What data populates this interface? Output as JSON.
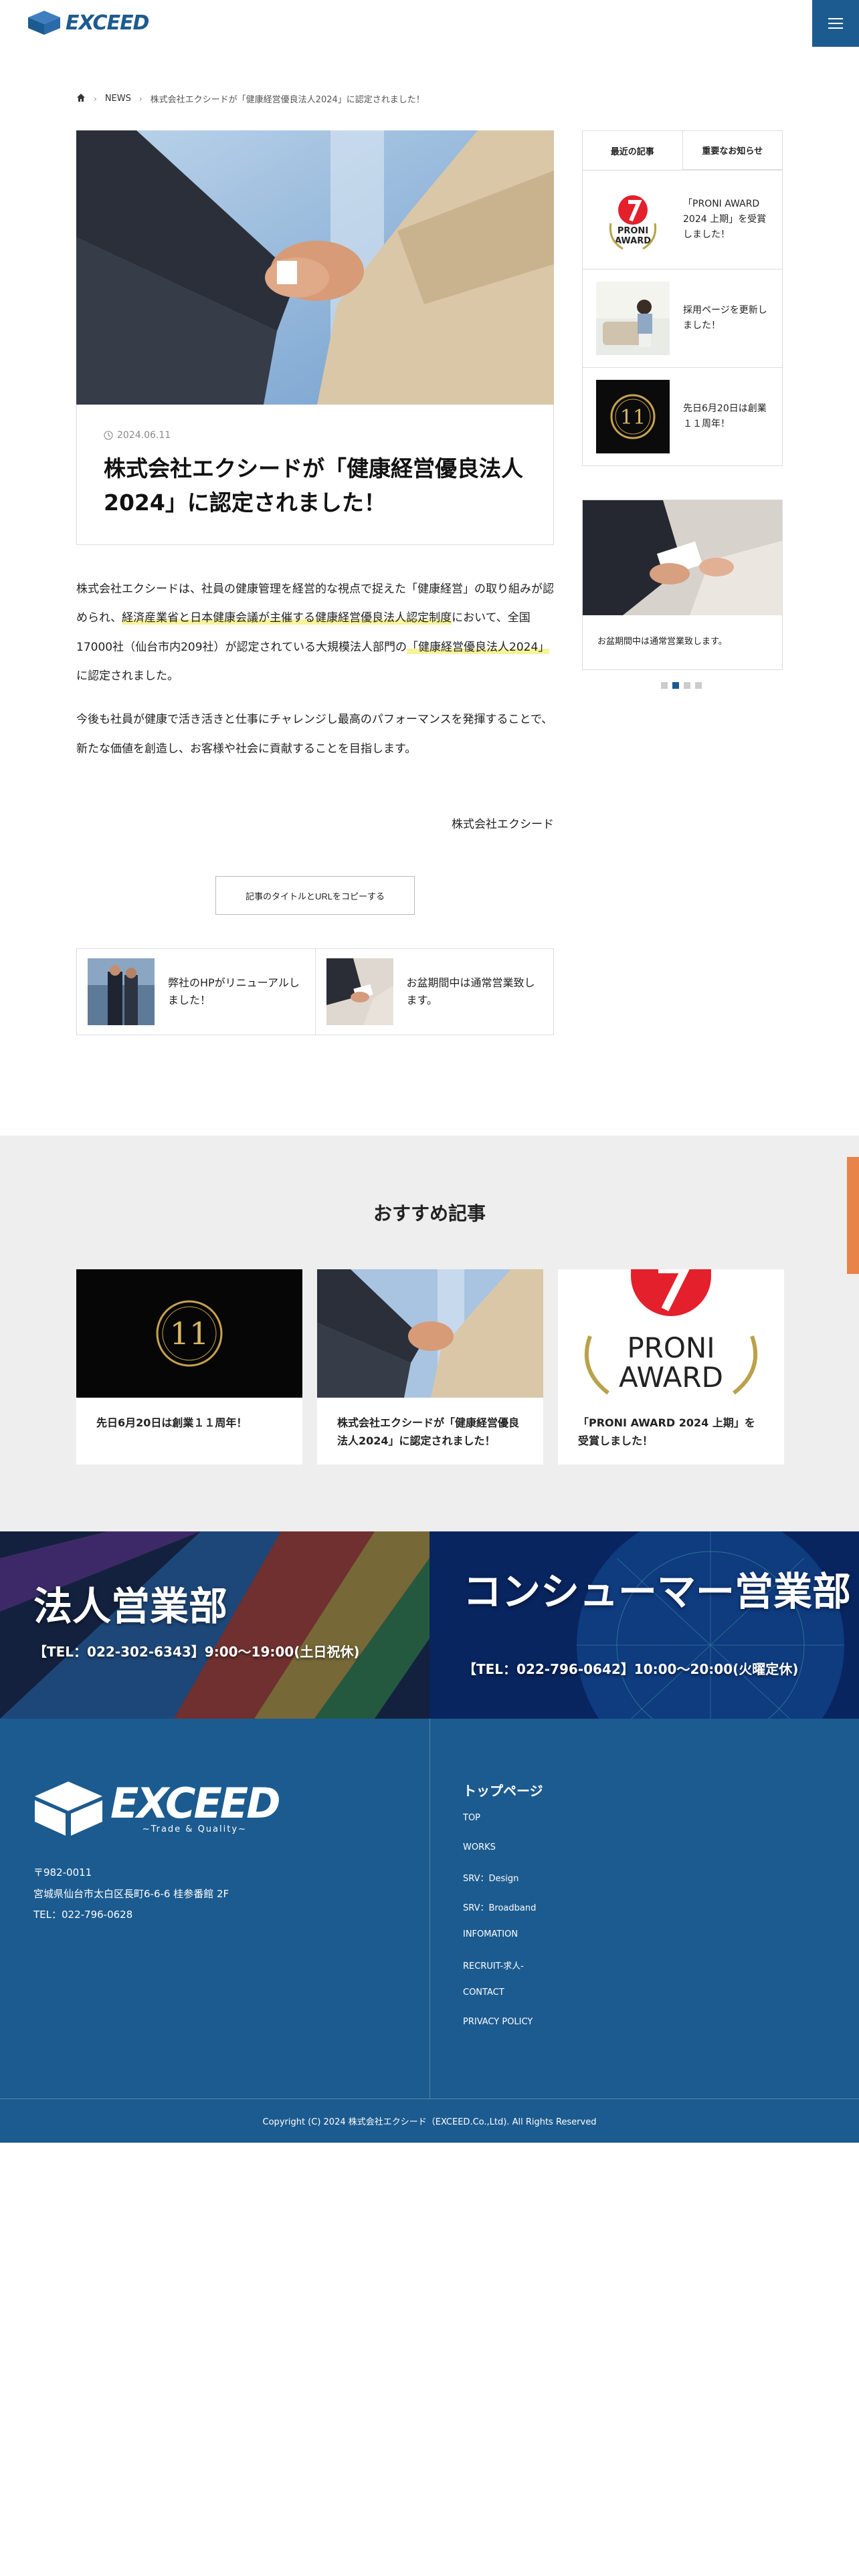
{
  "header": {
    "logo_text": "EXCEED",
    "menu_icon": "hamburger-icon"
  },
  "breadcrumb": {
    "home_icon": "home-icon",
    "category": "NEWS",
    "current": "株式会社エクシードが「健康経営優良法人2024」に認定されました！"
  },
  "article": {
    "date": "2024.06.11",
    "title": "株式会社エクシードが「健康経営優良法人2024」に認定されました！",
    "p1_a": "株式会社エクシードは、社員の健康管理を経営的な視点で捉えた「健康経営」の取り組みが認められ、",
    "p1_b": "経済産業省と日本健康会議が主催する健康経営優良法人認定制度",
    "p1_c": "において、全国17000社（仙台市内209社）が認定されている大規模法人部門の",
    "p1_d": "「健康経営優良法人2024」",
    "p1_e": "に認定されました。",
    "p2": "今後も社員が健康で活き活きと仕事にチャレンジし最高のパフォーマンスを発揮することで、新たな価値を創造し、お客様や社会に貢献することを目指します。",
    "signature": "株式会社エクシード",
    "copy_button": "記事のタイトルとURLをコピーする",
    "prev": "弊社のHPがリニューアルしました！",
    "next": "お盆期間中は通常営業致します。"
  },
  "sidebar": {
    "tabs": [
      "最近の記事",
      "重要なお知らせ"
    ],
    "recent": [
      "「PRONI AWARD 2024 上期」を受賞しました！",
      "採用ページを更新しました！",
      "先日6月20日は創業１１周年！"
    ],
    "banner_text": "お盆期間中は通常営業致します。",
    "dots": 4,
    "active_dot": 2
  },
  "recommended": {
    "title": "おすすめ記事",
    "cards": [
      {
        "title": "先日6月20日は創業１１周年！"
      },
      {
        "title": "株式会社エクシードが「健康経営優良法人2024」に認定されました！"
      },
      {
        "title": "「PRONI AWARD 2024 上期」を受賞しました！"
      }
    ],
    "award_text_1": "PRONI",
    "award_text_2": "AWARD",
    "badge_text": "11"
  },
  "sales": {
    "corporate_title": "法人営業部",
    "corporate_tel": "【TEL：022-302-6343】9:00〜19:00(土日祝休)",
    "consumer_title": "コンシューマー営業部",
    "consumer_tel": "【TEL：022-796-0642】10:00〜20:00(火曜定休)"
  },
  "footer": {
    "logo_text": "EXCEED",
    "logo_sub": "~Trade & Quality~",
    "postal": "〒982-0011",
    "address": "宮城県仙台市太白区長町6-6-6 桂参番館 2F",
    "tel": "TEL：022-796-0628",
    "nav_title": "トップページ",
    "nav": [
      "TOP",
      "WORKS",
      "SRV：Design",
      "SRV：Broadband",
      "INFOMATION",
      "RECRUIT-求人-",
      "CONTACT",
      "PRIVACY POLICY"
    ],
    "copyright": "Copyright (C) 2024 株式会社エクシード（EXCEED.Co.,Ltd). All Rights Reserved"
  },
  "colors": {
    "brand": "#1c5b8f",
    "highlight": "#f6f39a",
    "side_tab": "#e8844a"
  }
}
